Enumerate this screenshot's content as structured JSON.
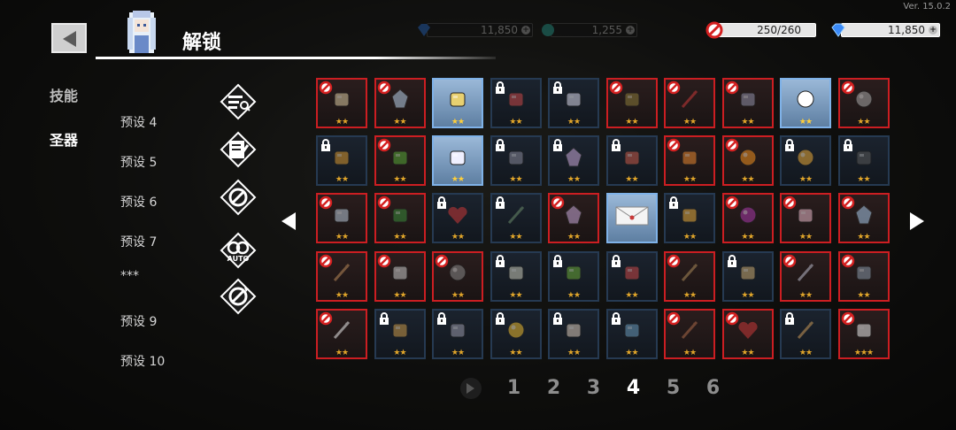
{
  "version": "Ver. 15.0.2",
  "header": {
    "title": "解锁",
    "back_label": "back"
  },
  "resources": [
    {
      "name": "gems",
      "value": "11,850",
      "icon": "gem-icon",
      "faded": true
    },
    {
      "name": "green-currency",
      "value": "1,255",
      "icon": "coin-icon",
      "faded": true
    },
    {
      "name": "unlock-limit",
      "value": "250/260",
      "icon": "no-entry-icon",
      "faded": false
    },
    {
      "name": "gems",
      "value": "11,850",
      "icon": "gem-icon",
      "faded": false
    }
  ],
  "categories": [
    {
      "label": "技能",
      "active": false
    },
    {
      "label": "圣器",
      "active": true
    }
  ],
  "presets": [
    "预设 4",
    "预设 5",
    "预设 6",
    "预设 7",
    "***",
    "预设 9",
    "预设 10"
  ],
  "side_icons": [
    "filter-search-icon",
    "scroll-pen-icon",
    "block-all-icon",
    "auto-ring-icon",
    "block-refresh-icon"
  ],
  "grid": {
    "rows": [
      [
        {
          "state": "blocked",
          "stars": "★★",
          "item": "mask-icon"
        },
        {
          "state": "blocked",
          "stars": "★★",
          "item": "ice-cube-icon"
        },
        {
          "state": "unlocked",
          "stars": "★★",
          "item": "egg-nest-icon"
        },
        {
          "state": "locked",
          "stars": "★★",
          "item": "ufo-icon"
        },
        {
          "state": "locked",
          "stars": "★★",
          "item": "moon-blade-icon"
        },
        {
          "state": "blocked",
          "stars": "★★",
          "item": "vest-icon"
        },
        {
          "state": "blocked",
          "stars": "★★",
          "item": "pencil-icon"
        },
        {
          "state": "blocked",
          "stars": "★★",
          "item": "gauntlet-icon"
        },
        {
          "state": "unlocked",
          "stars": "★★",
          "item": "apple-icon"
        },
        {
          "state": "blocked",
          "stars": "★★",
          "item": "orb-icon"
        }
      ],
      [
        {
          "state": "locked",
          "stars": "★★",
          "item": "medal-icon"
        },
        {
          "state": "blocked",
          "stars": "★★",
          "item": "leaf-icon"
        },
        {
          "state": "unlocked",
          "stars": "★★",
          "item": "flower-icon"
        },
        {
          "state": "locked",
          "stars": "★★",
          "item": "vortex-icon"
        },
        {
          "state": "locked",
          "stars": "★★",
          "item": "crystal-icon"
        },
        {
          "state": "locked",
          "stars": "★★",
          "item": "jar-icon"
        },
        {
          "state": "blocked",
          "stars": "★★",
          "item": "peace-icon"
        },
        {
          "state": "blocked",
          "stars": "★★",
          "item": "orange-icon"
        },
        {
          "state": "locked",
          "stars": "★★",
          "item": "planet-icon"
        },
        {
          "state": "locked",
          "stars": "★★",
          "item": "pot-icon"
        }
      ],
      [
        {
          "state": "blocked",
          "stars": "★★",
          "item": "cloud-icon"
        },
        {
          "state": "blocked",
          "stars": "★★",
          "item": "bush-icon"
        },
        {
          "state": "locked",
          "stars": "★★",
          "item": "heart-stone-icon"
        },
        {
          "state": "locked",
          "stars": "★★",
          "item": "dagger-icon"
        },
        {
          "state": "blocked",
          "stars": "★★",
          "item": "gem-rock-icon"
        },
        {
          "state": "unlocked",
          "stars": "",
          "item": "envelope-icon"
        },
        {
          "state": "locked",
          "stars": "★★",
          "item": "ring-icon"
        },
        {
          "state": "blocked",
          "stars": "★★",
          "item": "eye-orb-icon"
        },
        {
          "state": "blocked",
          "stars": "★★",
          "item": "shell-pearl-icon"
        },
        {
          "state": "blocked",
          "stars": "★★",
          "item": "shard-icon"
        }
      ],
      [
        {
          "state": "blocked",
          "stars": "★★",
          "item": "stick-icon"
        },
        {
          "state": "blocked",
          "stars": "★★",
          "item": "magnifier-icon"
        },
        {
          "state": "blocked",
          "stars": "★★",
          "item": "shield-icon"
        },
        {
          "state": "locked",
          "stars": "★★",
          "item": "wings-icon"
        },
        {
          "state": "locked",
          "stars": "★★",
          "item": "plant-pot-icon"
        },
        {
          "state": "locked",
          "stars": "★★",
          "item": "glasses-icon"
        },
        {
          "state": "blocked",
          "stars": "★★",
          "item": "spear-icon"
        },
        {
          "state": "locked",
          "stars": "★★",
          "item": "compass-icon"
        },
        {
          "state": "blocked",
          "stars": "★★",
          "item": "cane-icon"
        },
        {
          "state": "blocked",
          "stars": "★★",
          "item": "gear-ring-icon"
        }
      ],
      [
        {
          "state": "blocked",
          "stars": "★★",
          "item": "feather-icon"
        },
        {
          "state": "locked",
          "stars": "★★",
          "item": "box-icon"
        },
        {
          "state": "locked",
          "stars": "★★",
          "item": "cape-icon"
        },
        {
          "state": "locked",
          "stars": "★★",
          "item": "gold-coin-icon"
        },
        {
          "state": "locked",
          "stars": "★★",
          "item": "scroll-icon"
        },
        {
          "state": "locked",
          "stars": "★★",
          "item": "fish-icon"
        },
        {
          "state": "blocked",
          "stars": "★★",
          "item": "twig-icon"
        },
        {
          "state": "blocked",
          "stars": "★★",
          "item": "heart-icon"
        },
        {
          "state": "locked",
          "stars": "★★",
          "item": "staff-icon"
        },
        {
          "state": "blocked",
          "stars": "★★★",
          "item": "flask-icon"
        }
      ]
    ]
  },
  "pagination": {
    "pages": [
      "1",
      "2",
      "3",
      "4",
      "5",
      "6"
    ],
    "active": "4"
  },
  "colors": {
    "blocked_border": "#cc1e22",
    "unlocked_border": "#7fb2e8",
    "star": "#e0a52a"
  }
}
